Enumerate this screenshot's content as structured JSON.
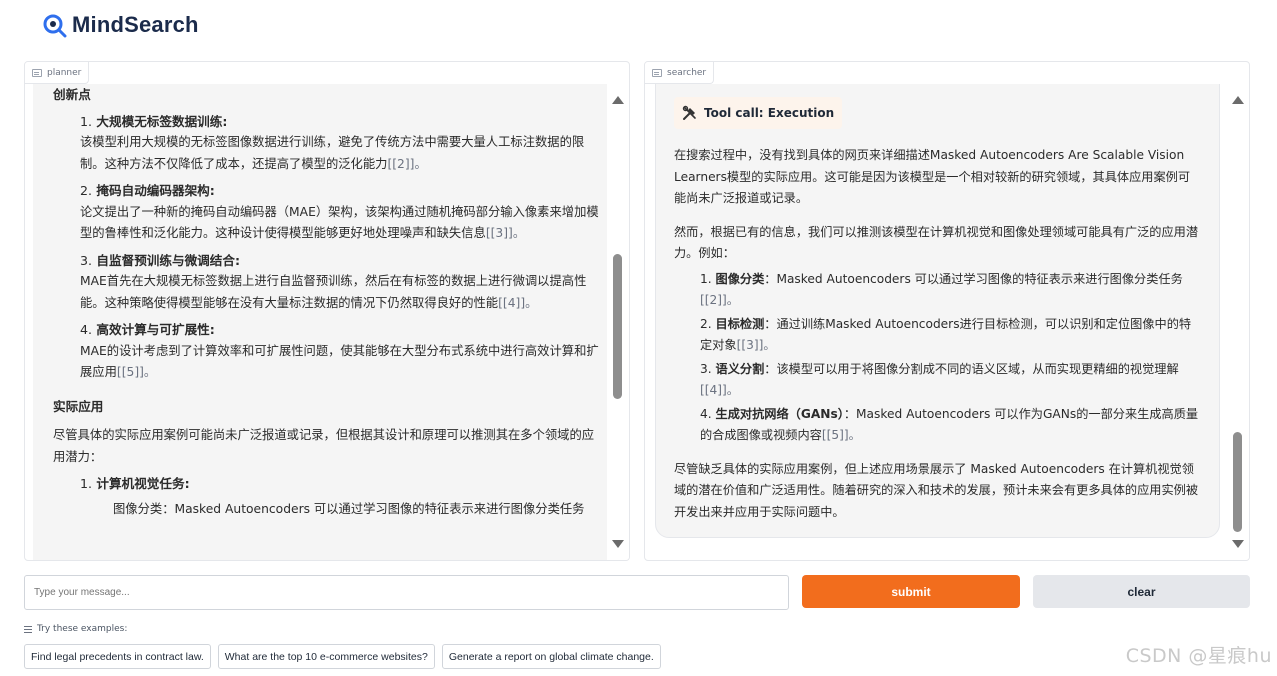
{
  "app": {
    "title": "MindSearch",
    "accent_color": "#f26d1d",
    "logo_color": "#1b2b4b"
  },
  "planner": {
    "label": "planner",
    "sections": {
      "innovation_title": "创新点",
      "items": [
        {
          "num": "1.",
          "title": "大规模无标签数据训练",
          "colon": ":",
          "body": "该模型利用大规模的无标签图像数据进行训练，避免了传统方法中需要大量人工标注数据的限制。这种方法不仅降低了成本，还提高了模型的泛化能力",
          "cite": "[[2]]。"
        },
        {
          "num": "2.",
          "title": "掩码自动编码器架构",
          "colon": ":",
          "body": "论文提出了一种新的掩码自动编码器（MAE）架构，该架构通过随机掩码部分输入像素来增加模型的鲁棒性和泛化能力。这种设计使得模型能够更好地处理噪声和缺失信息",
          "cite": "[[3]]。"
        },
        {
          "num": "3.",
          "title": "自监督预训练与微调结合",
          "colon": ":",
          "body": "MAE首先在大规模无标签数据上进行自监督预训练，然后在有标签的数据上进行微调以提高性能。这种策略使得模型能够在没有大量标注数据的情况下仍然取得良好的性能",
          "cite": "[[4]]。"
        },
        {
          "num": "4.",
          "title": "高效计算与可扩展性",
          "colon": ":",
          "body": "MAE的设计考虑到了计算效率和可扩展性问题，使其能够在大型分布式系统中进行高效计算和扩展应用",
          "cite": "[[5]]。"
        }
      ],
      "application_title": "实际应用",
      "application_intro": "尽管具体的实际应用案例可能尚未广泛报道或记录，但根据其设计和原理可以推测其在多个领域的应用潜力：",
      "cv_task_num": "1.",
      "cv_task_title": "计算机视觉任务",
      "cv_task_colon": ":",
      "cut_off_line": "图像分类：Masked Autoencoders 可以通过学习图像的特征表示来进行图像分类任务"
    },
    "scrollbar": {
      "thumb_fraction": 0.32,
      "position_fraction": 0.36
    }
  },
  "searcher": {
    "label": "searcher",
    "tool_call": "Tool call: Execution",
    "para1": "在搜索过程中，没有找到具体的网页来详细描述Masked Autoencoders Are Scalable Vision Learners模型的实际应用。这可能是因为该模型是一个相对较新的研究领域，其具体应用案例可能尚未广泛报道或记录。",
    "para2": "然而，根据已有的信息，我们可以推测该模型在计算机视觉和图像处理领域可能具有广泛的应用潜力。例如：",
    "items": [
      {
        "num": "1.",
        "title": "图像分类",
        "text": "：Masked Autoencoders 可以通过学习图像的特征表示来进行图像分类任务",
        "cite": "[[2]]。"
      },
      {
        "num": "2.",
        "title": "目标检测",
        "text": "：通过训练Masked Autoencoders进行目标检测，可以识别和定位图像中的特定对象",
        "cite": "[[3]]。"
      },
      {
        "num": "3.",
        "title": "语义分割",
        "text": "：该模型可以用于将图像分割成不同的语义区域，从而实现更精细的视觉理解",
        "cite": "[[4]]。"
      },
      {
        "num": "4.",
        "title": "生成对抗网络（GANs）",
        "text": "：Masked Autoencoders 可以作为GANs的一部分来生成高质量的合成图像或视频内容",
        "cite": "[[5]]。"
      }
    ],
    "para3": "尽管缺乏具体的实际应用案例，但上述应用场景展示了 Masked Autoencoders 在计算机视觉领域的潜在价值和广泛适用性。随着研究的深入和技术的发展，预计未来会有更多具体的应用实例被开发出来并应用于实际问题中。",
    "scrollbar": {
      "thumb_fraction": 0.22,
      "position_fraction": 0.92
    }
  },
  "input": {
    "placeholder": "Type your message..."
  },
  "buttons": {
    "submit": "submit",
    "clear": "clear"
  },
  "examples": {
    "label": "Try these examples:",
    "items": [
      "Find legal precedents in contract law.",
      "What are the top 10 e-commerce websites?",
      "Generate a report on global climate change."
    ]
  },
  "watermark": "CSDN @星痕hu",
  "icons": {
    "logo": "mindsearch-logo-icon",
    "panel": "chat-icon",
    "tool": "tools-icon",
    "examples": "list-icon"
  }
}
